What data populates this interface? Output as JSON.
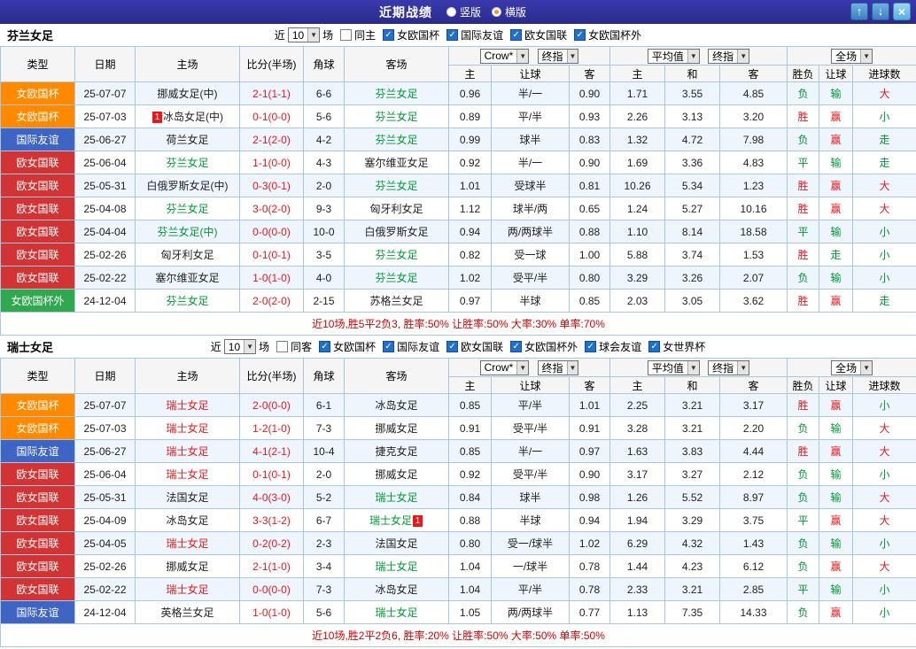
{
  "titlebar": {
    "title": "近期战绩",
    "vertical_label": "竖版",
    "horizontal_label": "横版",
    "selected_mode": "横版",
    "up_icon": "↑",
    "down_icon": "↓",
    "close_icon": "×"
  },
  "table_headers": {
    "type": "类型",
    "date": "日期",
    "home": "主场",
    "score": "比分(半场)",
    "corner": "角球",
    "away": "客场",
    "g1_dd1": "Crow*",
    "g1_dd2": "终指",
    "g2_dd1": "平均值",
    "g2_dd2": "终指",
    "g3_dd": "全场",
    "sub": [
      "主",
      "让球",
      "客",
      "主",
      "和",
      "客",
      "胜负",
      "让球",
      "进球数"
    ]
  },
  "colors": {
    "league": {
      "女欧国杯": "#ff8a00",
      "国际友谊": "#3e64c4",
      "欧女国联": "#d23435",
      "女欧国杯外": "#2fa84e"
    },
    "result_map": {
      "胜": "red",
      "赢": "red",
      "大": "red",
      "平": "green",
      "走": "green",
      "负": "green",
      "输": "green",
      "小": "green"
    },
    "score_red": "#e8191c",
    "focal_green": "#009933",
    "summary_red": "#d30000"
  },
  "tables": [
    {
      "team": "芬兰女足",
      "filters": {
        "near": "近",
        "count": "10",
        "games": "场",
        "same": {
          "label": "同主",
          "checked": false
        },
        "leagues": [
          {
            "label": "女欧国杯",
            "checked": true
          },
          {
            "label": "国际友谊",
            "checked": true
          },
          {
            "label": "欧女国联",
            "checked": true
          },
          {
            "label": "女欧国杯外",
            "checked": true
          }
        ]
      },
      "rows": [
        {
          "league": "女欧国杯",
          "date": "25-07-07",
          "home": "挪威女足(中)",
          "home_style": "normal",
          "home_badge": "",
          "score": "2-1(1-1)",
          "corner": "6-6",
          "away": "芬兰女足",
          "away_style": "focal-green",
          "away_badge": "",
          "odds": [
            "0.96",
            "半/一",
            "0.90",
            "1.71",
            "3.55",
            "4.85"
          ],
          "results": [
            "负",
            "输",
            "大"
          ]
        },
        {
          "league": "女欧国杯",
          "date": "25-07-03",
          "home": "冰岛女足(中)",
          "home_style": "normal",
          "home_badge": "1",
          "score": "0-1(0-0)",
          "corner": "5-6",
          "away": "芬兰女足",
          "away_style": "focal-green",
          "away_badge": "",
          "odds": [
            "0.89",
            "平/半",
            "0.93",
            "2.26",
            "3.13",
            "3.20"
          ],
          "results": [
            "胜",
            "赢",
            "小"
          ]
        },
        {
          "league": "国际友谊",
          "date": "25-06-27",
          "home": "荷兰女足",
          "home_style": "normal",
          "home_badge": "",
          "score": "2-1(2-0)",
          "corner": "4-2",
          "away": "芬兰女足",
          "away_style": "focal-green",
          "away_badge": "",
          "odds": [
            "0.99",
            "球半",
            "0.83",
            "1.32",
            "4.72",
            "7.98"
          ],
          "results": [
            "负",
            "赢",
            "走"
          ]
        },
        {
          "league": "欧女国联",
          "date": "25-06-04",
          "home": "芬兰女足",
          "home_style": "focal-green",
          "home_badge": "",
          "score": "1-1(0-0)",
          "corner": "4-3",
          "away": "塞尔维亚女足",
          "away_style": "normal",
          "away_badge": "",
          "odds": [
            "0.92",
            "半/一",
            "0.90",
            "1.69",
            "3.36",
            "4.83"
          ],
          "results": [
            "平",
            "输",
            "走"
          ]
        },
        {
          "league": "欧女国联",
          "date": "25-05-31",
          "home": "白俄罗斯女足(中)",
          "home_style": "normal",
          "home_badge": "",
          "score": "0-3(0-1)",
          "corner": "2-0",
          "away": "芬兰女足",
          "away_style": "focal-green",
          "away_badge": "",
          "odds": [
            "1.01",
            "受球半",
            "0.81",
            "10.26",
            "5.34",
            "1.23"
          ],
          "results": [
            "胜",
            "赢",
            "大"
          ]
        },
        {
          "league": "欧女国联",
          "date": "25-04-08",
          "home": "芬兰女足",
          "home_style": "focal-green",
          "home_badge": "",
          "score": "3-0(2-0)",
          "corner": "9-3",
          "away": "匈牙利女足",
          "away_style": "normal",
          "away_badge": "",
          "odds": [
            "1.12",
            "球半/两",
            "0.65",
            "1.24",
            "5.27",
            "10.16"
          ],
          "results": [
            "胜",
            "赢",
            "大"
          ]
        },
        {
          "league": "欧女国联",
          "date": "25-04-04",
          "home": "芬兰女足(中)",
          "home_style": "focal-green",
          "home_badge": "",
          "score": "0-0(0-0)",
          "corner": "10-0",
          "away": "白俄罗斯女足",
          "away_style": "normal",
          "away_badge": "",
          "odds": [
            "0.94",
            "两/两球半",
            "0.88",
            "1.10",
            "8.14",
            "18.58"
          ],
          "results": [
            "平",
            "输",
            "小"
          ]
        },
        {
          "league": "欧女国联",
          "date": "25-02-26",
          "home": "匈牙利女足",
          "home_style": "normal",
          "home_badge": "",
          "score": "0-1(0-1)",
          "corner": "3-5",
          "away": "芬兰女足",
          "away_style": "focal-green",
          "away_badge": "",
          "odds": [
            "0.82",
            "受一球",
            "1.00",
            "5.88",
            "3.74",
            "1.53"
          ],
          "results": [
            "胜",
            "走",
            "小"
          ]
        },
        {
          "league": "欧女国联",
          "date": "25-02-22",
          "home": "塞尔维亚女足",
          "home_style": "normal",
          "home_badge": "",
          "score": "1-0(1-0)",
          "corner": "4-0",
          "away": "芬兰女足",
          "away_style": "focal-green",
          "away_badge": "",
          "odds": [
            "1.02",
            "受平/半",
            "0.80",
            "3.29",
            "3.26",
            "2.07"
          ],
          "results": [
            "负",
            "输",
            "小"
          ]
        },
        {
          "league": "女欧国杯外",
          "date": "24-12-04",
          "home": "芬兰女足",
          "home_style": "focal-green",
          "home_badge": "",
          "score": "2-0(2-0)",
          "corner": "2-15",
          "away": "苏格兰女足",
          "away_style": "normal",
          "away_badge": "",
          "odds": [
            "0.97",
            "半球",
            "0.85",
            "2.03",
            "3.05",
            "3.62"
          ],
          "results": [
            "胜",
            "赢",
            "走"
          ]
        }
      ],
      "summary": "近10场,胜5平2负3, 胜率:50% 让胜率:50% 大率:30% 单率:70%"
    },
    {
      "team": "瑞士女足",
      "filters": {
        "near": "近",
        "count": "10",
        "games": "场",
        "same": {
          "label": "同客",
          "checked": false
        },
        "leagues": [
          {
            "label": "女欧国杯",
            "checked": true
          },
          {
            "label": "国际友谊",
            "checked": true
          },
          {
            "label": "欧女国联",
            "checked": true
          },
          {
            "label": "女欧国杯外",
            "checked": true
          },
          {
            "label": "球会友谊",
            "checked": true
          },
          {
            "label": "女世界杯",
            "checked": true
          }
        ]
      },
      "rows": [
        {
          "league": "女欧国杯",
          "date": "25-07-07",
          "home": "瑞士女足",
          "home_style": "focal-red",
          "home_badge": "",
          "score": "2-0(0-0)",
          "corner": "6-1",
          "away": "冰岛女足",
          "away_style": "normal",
          "away_badge": "",
          "odds": [
            "0.85",
            "平/半",
            "1.01",
            "2.25",
            "3.21",
            "3.17"
          ],
          "results": [
            "胜",
            "赢",
            "小"
          ]
        },
        {
          "league": "女欧国杯",
          "date": "25-07-03",
          "home": "瑞士女足",
          "home_style": "focal-red",
          "home_badge": "",
          "score": "1-2(1-0)",
          "corner": "7-3",
          "away": "挪威女足",
          "away_style": "normal",
          "away_badge": "",
          "odds": [
            "0.91",
            "受平/半",
            "0.91",
            "3.28",
            "3.21",
            "2.20"
          ],
          "results": [
            "负",
            "输",
            "大"
          ]
        },
        {
          "league": "国际友谊",
          "date": "25-06-27",
          "home": "瑞士女足",
          "home_style": "focal-red",
          "home_badge": "",
          "score": "4-1(2-1)",
          "corner": "10-4",
          "away": "捷克女足",
          "away_style": "normal",
          "away_badge": "",
          "odds": [
            "0.85",
            "半/一",
            "0.97",
            "1.63",
            "3.83",
            "4.44"
          ],
          "results": [
            "胜",
            "赢",
            "大"
          ]
        },
        {
          "league": "欧女国联",
          "date": "25-06-04",
          "home": "瑞士女足",
          "home_style": "focal-red",
          "home_badge": "",
          "score": "0-1(0-1)",
          "corner": "2-0",
          "away": "挪威女足",
          "away_style": "normal",
          "away_badge": "",
          "odds": [
            "0.92",
            "受平/半",
            "0.90",
            "3.17",
            "3.27",
            "2.12"
          ],
          "results": [
            "负",
            "输",
            "小"
          ]
        },
        {
          "league": "欧女国联",
          "date": "25-05-31",
          "home": "法国女足",
          "home_style": "normal",
          "home_badge": "",
          "score": "4-0(3-0)",
          "corner": "5-2",
          "away": "瑞士女足",
          "away_style": "focal-green",
          "away_badge": "",
          "odds": [
            "0.84",
            "球半",
            "0.98",
            "1.26",
            "5.52",
            "8.97"
          ],
          "results": [
            "负",
            "输",
            "大"
          ]
        },
        {
          "league": "欧女国联",
          "date": "25-04-09",
          "home": "冰岛女足",
          "home_style": "normal",
          "home_badge": "",
          "score": "3-3(1-2)",
          "corner": "6-7",
          "away": "瑞士女足",
          "away_style": "focal-green",
          "away_badge": "1",
          "odds": [
            "0.88",
            "半球",
            "0.94",
            "1.94",
            "3.29",
            "3.75"
          ],
          "results": [
            "平",
            "赢",
            "大"
          ]
        },
        {
          "league": "欧女国联",
          "date": "25-04-05",
          "home": "瑞士女足",
          "home_style": "focal-red",
          "home_badge": "",
          "score": "0-2(0-2)",
          "corner": "2-3",
          "away": "法国女足",
          "away_style": "normal",
          "away_badge": "",
          "odds": [
            "0.80",
            "受一/球半",
            "1.02",
            "6.29",
            "4.32",
            "1.43"
          ],
          "results": [
            "负",
            "输",
            "小"
          ]
        },
        {
          "league": "欧女国联",
          "date": "25-02-26",
          "home": "挪威女足",
          "home_style": "normal",
          "home_badge": "",
          "score": "2-1(1-0)",
          "corner": "3-4",
          "away": "瑞士女足",
          "away_style": "focal-green",
          "away_badge": "",
          "odds": [
            "1.04",
            "一/球半",
            "0.78",
            "1.44",
            "4.23",
            "6.12"
          ],
          "results": [
            "负",
            "赢",
            "大"
          ]
        },
        {
          "league": "欧女国联",
          "date": "25-02-22",
          "home": "瑞士女足",
          "home_style": "focal-red",
          "home_badge": "",
          "score": "0-0(0-0)",
          "corner": "7-3",
          "away": "冰岛女足",
          "away_style": "normal",
          "away_badge": "",
          "odds": [
            "1.04",
            "平/半",
            "0.78",
            "2.33",
            "3.21",
            "2.85"
          ],
          "results": [
            "平",
            "输",
            "小"
          ]
        },
        {
          "league": "国际友谊",
          "date": "24-12-04",
          "home": "英格兰女足",
          "home_style": "normal",
          "home_badge": "",
          "score": "1-0(1-0)",
          "corner": "5-6",
          "away": "瑞士女足",
          "away_style": "focal-green",
          "away_badge": "",
          "odds": [
            "1.05",
            "两/两球半",
            "0.77",
            "1.13",
            "7.35",
            "14.33"
          ],
          "results": [
            "负",
            "赢",
            "小"
          ]
        }
      ],
      "summary": "近10场,胜2平2负6, 胜率:20% 让胜率:50% 大率:50% 单率:50%"
    }
  ]
}
